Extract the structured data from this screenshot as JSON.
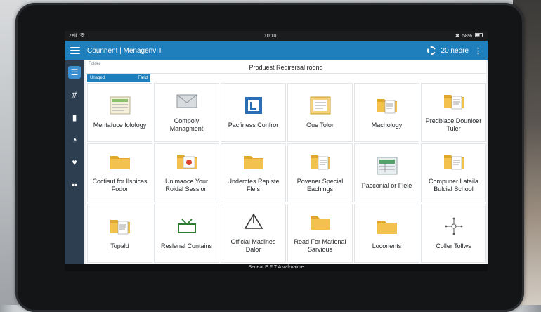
{
  "statusbar": {
    "left_text": "Zeil",
    "time": "10:10",
    "battery": "58%"
  },
  "appbar": {
    "title": "Counnent | MenagenvIT",
    "right_text": "20 neore"
  },
  "content": {
    "small_label": "Folder",
    "title": "Produest Redirersal roono",
    "selection": {
      "left": "Unaqed",
      "right": "Farid"
    }
  },
  "tiles": [
    {
      "label": "Mentafuce folology",
      "icon": "form-icon"
    },
    {
      "label": "Compoly Managment",
      "icon": "envelope-icon"
    },
    {
      "label": "Pacfiness Confror",
      "icon": "document-blue-icon"
    },
    {
      "label": "Oue Tolor",
      "icon": "notepad-icon"
    },
    {
      "label": "Machology",
      "icon": "folder-doc-icon"
    },
    {
      "label": "Predblace Dounloer Tuler",
      "icon": "folder-doc-icon"
    },
    {
      "label": "Coctisut for Ilspicas Fodor",
      "icon": "folder-icon"
    },
    {
      "label": "Unimaoce Your Roidal Session",
      "icon": "folder-photo-icon"
    },
    {
      "label": "Underctes Replste Flels",
      "icon": "folder-icon"
    },
    {
      "label": "Povener Special Eachings",
      "icon": "folder-doc-icon"
    },
    {
      "label": "Pacconial or Flele",
      "icon": "spreadsheet-icon"
    },
    {
      "label": "Compuner Lataila Bulcial School",
      "icon": "folder-doc-icon"
    },
    {
      "label": "Topald",
      "icon": "folder-doc-icon"
    },
    {
      "label": "Reslenal Contains",
      "icon": "box-icon"
    },
    {
      "label": "Official Madines Dalor",
      "icon": "triangle-icon"
    },
    {
      "label": "Read For Mational Sarvious",
      "icon": "folder-icon"
    },
    {
      "label": "Loconents",
      "icon": "folder-icon"
    },
    {
      "label": "Coller Tollws",
      "icon": "network-icon"
    }
  ],
  "bottombar": {
    "text": "Seceat E F T A vaf-naime"
  }
}
